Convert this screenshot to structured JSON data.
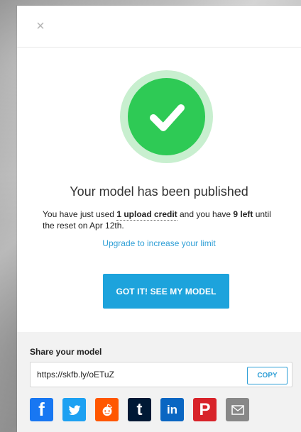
{
  "modal": {
    "close_glyph": "×",
    "title": "Your model has been published",
    "message": {
      "prefix": "You have just used ",
      "credit_strong": "1 upload credit",
      "middle": " and you have ",
      "left_strong": "9 left",
      "suffix": " until the reset on Apr 12th."
    },
    "upgrade_link": "Upgrade to increase your limit",
    "cta_button": "GOT IT! SEE MY MODEL"
  },
  "share": {
    "title": "Share your model",
    "url": "https://skfb.ly/oETuZ",
    "copy_label": "COPY",
    "icons": [
      "facebook-icon",
      "twitter-icon",
      "reddit-icon",
      "tumblr-icon",
      "linkedin-icon",
      "pinterest-icon",
      "mail-icon"
    ]
  },
  "colors": {
    "success_green": "#2eca55",
    "success_ring": "#c8efcf",
    "accent_blue": "#1da3dc",
    "link_blue": "#2f9fd6"
  }
}
